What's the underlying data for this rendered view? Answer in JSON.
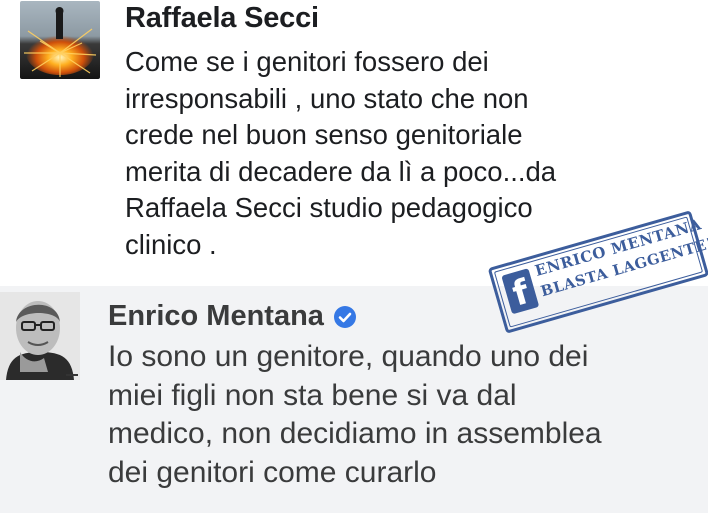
{
  "comments": [
    {
      "author": "Raffaela Secci",
      "lines": [
        "Come se i genitori fossero dei",
        "irresponsabili , uno stato che non",
        "crede nel buon senso genitoriale",
        "merita di decadere da lì a poco...da",
        "Raffaela Secci studio pedagogico",
        "clinico ."
      ]
    },
    {
      "author": "Enrico Mentana",
      "verified": true,
      "lines": [
        "Io sono un genitore, quando uno dei",
        "miei figli non sta bene si va dal",
        "medico, non decidiamo in assemblea",
        "dei genitori come curarlo"
      ]
    }
  ],
  "stamp": {
    "icon": "facebook-f-icon",
    "letter": "f",
    "line1": "ENRICO MENTANA",
    "line2": "BLASTA LAGGENTE!!!",
    "color": "#3c5d9c"
  },
  "colors": {
    "top_background": "#ffffff",
    "bottom_background": "#f2f3f5",
    "verified_badge": "#3578e5"
  }
}
